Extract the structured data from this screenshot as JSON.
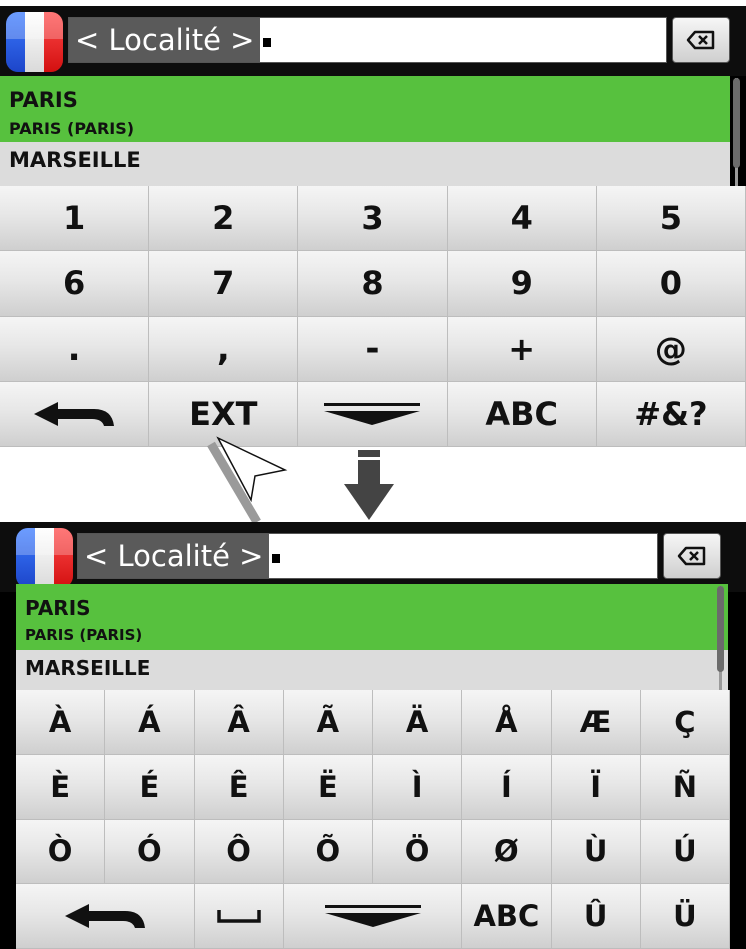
{
  "top": {
    "search": {
      "placeholder": "< Localité >"
    },
    "list": [
      {
        "title": "PARIS",
        "subtitle": "PARIS (PARIS)",
        "selected": true
      },
      {
        "title": "MARSEILLE",
        "selected": false
      }
    ],
    "keys": [
      [
        "1",
        "2",
        "3",
        "4",
        "5"
      ],
      [
        "6",
        "7",
        "8",
        "9",
        "0"
      ],
      [
        ".",
        ",",
        "-",
        "+",
        "@"
      ],
      [
        "",
        "EXT",
        "",
        "ABC",
        "#&?"
      ]
    ]
  },
  "bottom": {
    "search": {
      "placeholder": "< Localité >"
    },
    "list": [
      {
        "title": "PARIS",
        "subtitle": "PARIS (PARIS)",
        "selected": true
      },
      {
        "title": "MARSEILLE",
        "selected": false
      }
    ],
    "keys": [
      [
        "À",
        "Á",
        "Â",
        "Ã",
        "Ä",
        "Å",
        "Æ",
        "Ç"
      ],
      [
        "È",
        "É",
        "Ê",
        "Ë",
        "Ì",
        "Í",
        "Ï",
        "Ñ"
      ],
      [
        "Ò",
        "Ó",
        "Ô",
        "Õ",
        "Ö",
        "Ø",
        "Ù",
        "Ú"
      ],
      [
        "",
        "",
        "",
        "ABC",
        "Û",
        "Ü"
      ]
    ]
  },
  "icons": {
    "flag": "france-flag-icon",
    "delete": "backspace-icon",
    "back": "back-arrow-icon",
    "hide": "hide-keyboard-icon",
    "space": "space-bar-icon",
    "transition": "down-arrow-icon",
    "pointer": "pointer-cursor-icon"
  },
  "colors": {
    "selected_row": "#57c13e",
    "row": "#dcdcdc",
    "header": "#0d0d0d",
    "placeholder_bg": "#5a5a5a"
  }
}
